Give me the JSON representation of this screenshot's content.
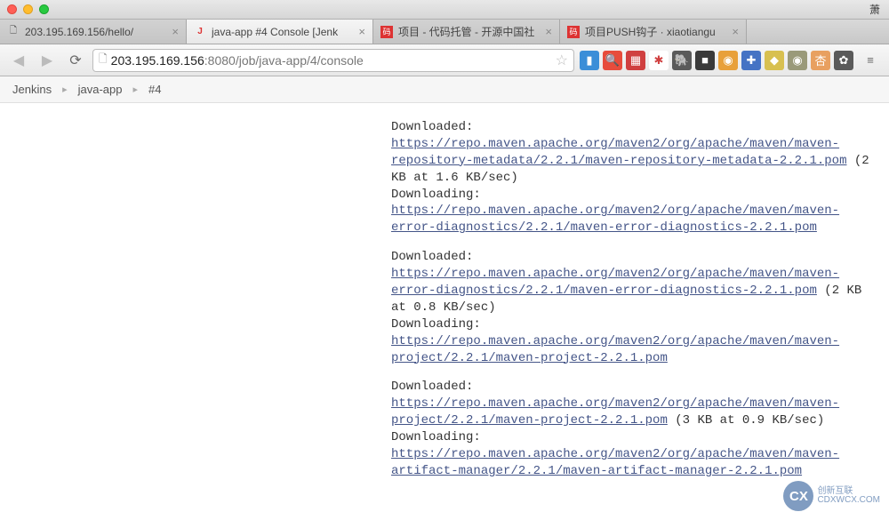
{
  "window": {
    "user": "萧"
  },
  "tabs": [
    {
      "label": "203.195.169.156/hello/",
      "favicon": "generic"
    },
    {
      "label": "java-app #4 Console [Jenk",
      "favicon": "jenkins",
      "active": true
    },
    {
      "label": "项目 - 代码托管 - 开源中国社",
      "favicon": "red"
    },
    {
      "label": "项目PUSH钩子 · xiaotiangu",
      "favicon": "red"
    }
  ],
  "address": {
    "host": "203.195.169.156",
    "port": ":8080",
    "path": "/job/java-app/4/console"
  },
  "breadcrumb": [
    {
      "label": "Jenkins"
    },
    {
      "label": "java-app"
    },
    {
      "label": "#4"
    }
  ],
  "console_blocks": [
    [
      {
        "t": "text",
        "v": "Downloaded: "
      },
      {
        "t": "link",
        "v": "https://repo.maven.apache.org/maven2/org/apache/maven/maven-repository-metadata/2.2.1/maven-repository-metadata-2.2.1.pom"
      },
      {
        "t": "text",
        "v": " (2 KB at 1.6 KB/sec)\nDownloading: "
      },
      {
        "t": "link",
        "v": "https://repo.maven.apache.org/maven2/org/apache/maven/maven-error-diagnostics/2.2.1/maven-error-diagnostics-2.2.1.pom"
      }
    ],
    [
      {
        "t": "text",
        "v": "Downloaded: "
      },
      {
        "t": "link",
        "v": "https://repo.maven.apache.org/maven2/org/apache/maven/maven-error-diagnostics/2.2.1/maven-error-diagnostics-2.2.1.pom"
      },
      {
        "t": "text",
        "v": " (2 KB at 0.8 KB/sec)\nDownloading: "
      },
      {
        "t": "link",
        "v": "https://repo.maven.apache.org/maven2/org/apache/maven/maven-project/2.2.1/maven-project-2.2.1.pom"
      }
    ],
    [
      {
        "t": "text",
        "v": "Downloaded: "
      },
      {
        "t": "link",
        "v": "https://repo.maven.apache.org/maven2/org/apache/maven/maven-project/2.2.1/maven-project-2.2.1.pom"
      },
      {
        "t": "text",
        "v": " (3 KB at 0.9 KB/sec)\nDownloading: "
      },
      {
        "t": "link",
        "v": "https://repo.maven.apache.org/maven2/org/apache/maven/maven-artifact-manager/2.2.1/maven-artifact-manager-2.2.1.pom"
      }
    ]
  ],
  "ext_colors": [
    "#3b8ed8",
    "#e74c3c",
    "#d04040",
    "#fff",
    "#5a5a5a",
    "#3a3a3a",
    "#e8a03a",
    "#4573c4",
    "#d8c050",
    "#9a9a7a",
    "#e8a060",
    "#5a5a5a"
  ],
  "watermark": {
    "badge": "CX",
    "line1": "创新互联",
    "line2": "CDXWCX.COM"
  }
}
